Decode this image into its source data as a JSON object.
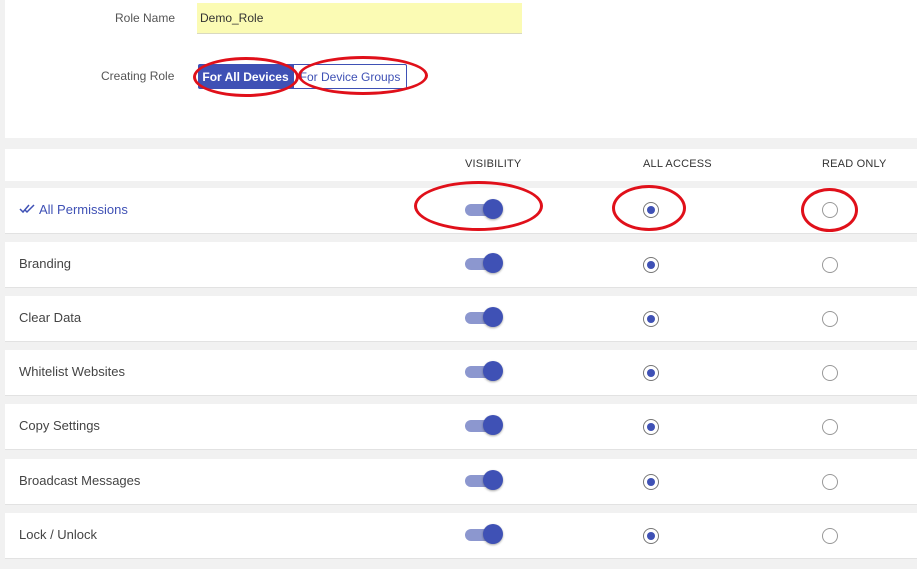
{
  "role_form": {
    "role_name_label": "Role Name",
    "role_name_value": "Demo_Role",
    "creating_role_label": "Creating Role",
    "for_all_devices": "For All Devices",
    "for_device_groups": "For Device Groups"
  },
  "columns": {
    "visibility": "VISIBILITY",
    "all_access": "ALL ACCESS",
    "read_only": "READ ONLY"
  },
  "permissions": [
    {
      "label": "All Permissions",
      "visibility": "on",
      "access": "all_access",
      "icon": "double-check-icon"
    },
    {
      "label": "Branding",
      "visibility": "on",
      "access": "all_access"
    },
    {
      "label": "Clear Data",
      "visibility": "on",
      "access": "all_access"
    },
    {
      "label": "Whitelist Websites",
      "visibility": "on",
      "access": "all_access"
    },
    {
      "label": "Copy Settings",
      "visibility": "on",
      "access": "all_access"
    },
    {
      "label": "Broadcast Messages",
      "visibility": "on",
      "access": "all_access"
    },
    {
      "label": "Lock / Unlock",
      "visibility": "on",
      "access": "all_access"
    }
  ],
  "colors": {
    "accent": "#3f51b5",
    "annotation": "#e0101a",
    "input_bg": "#fbfbb4"
  }
}
